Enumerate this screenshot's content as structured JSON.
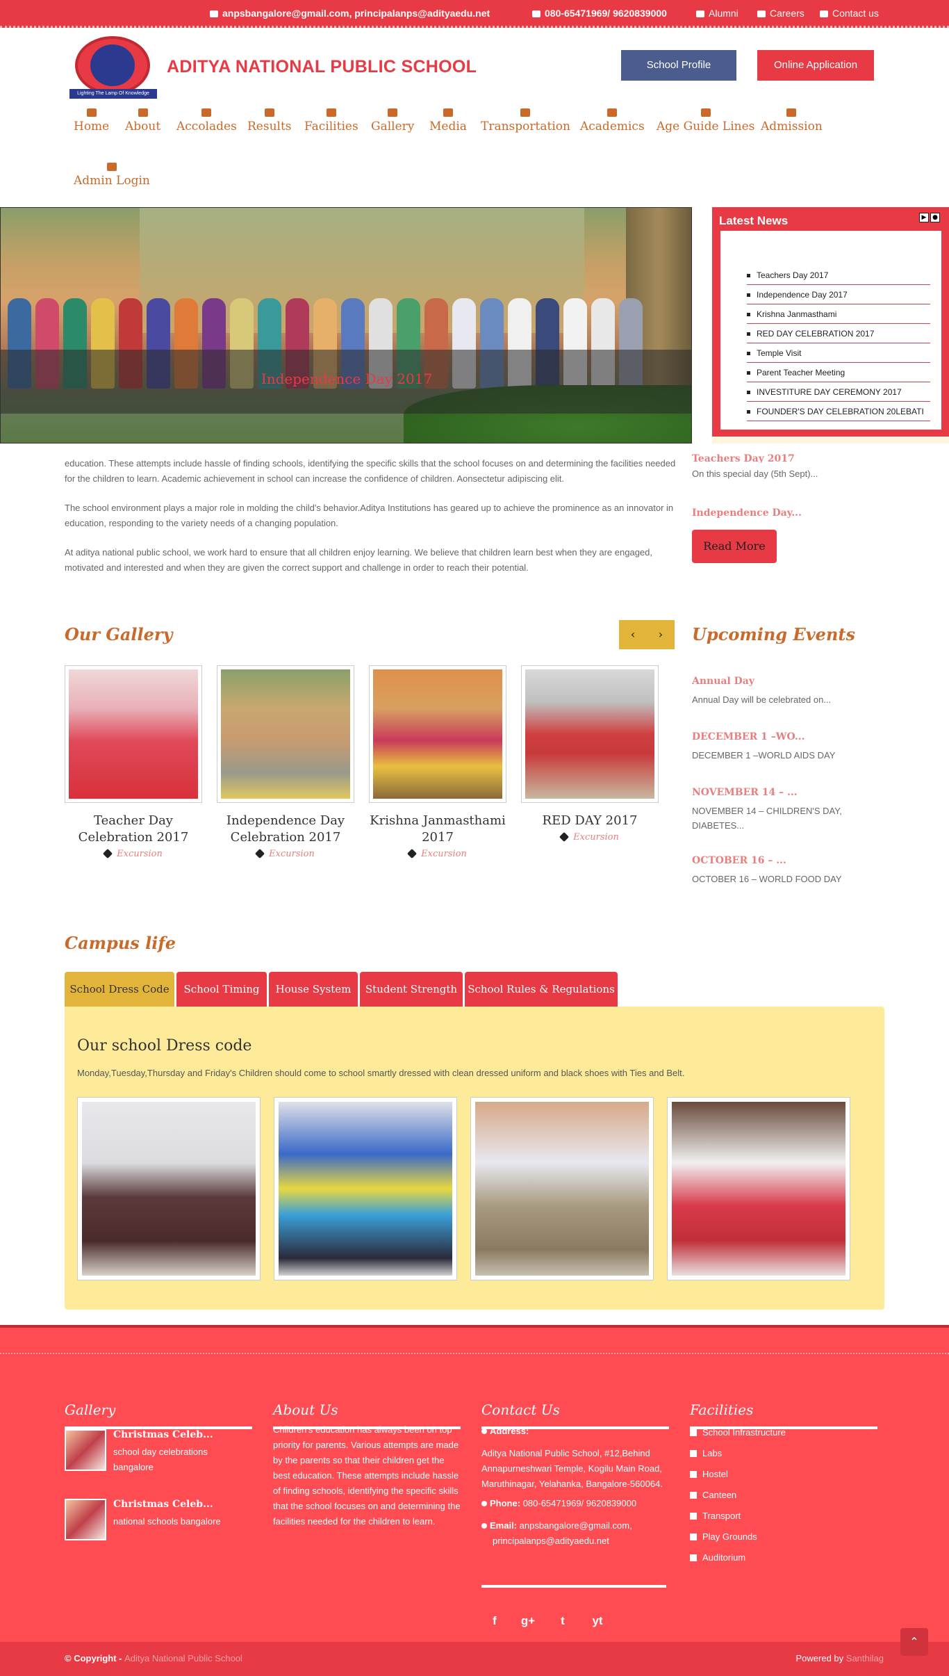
{
  "topbar": {
    "email": "anpsbangalore@gmail.com, principalanps@adityaedu.net",
    "phone": "080-65471969/ 9620839000",
    "links": [
      "Alumni",
      "Careers",
      "Contact us"
    ]
  },
  "header": {
    "logo_text": "Lighting The Lamp Of Knowledge",
    "title": "ADITYA NATIONAL PUBLIC SCHOOL",
    "profile_button": "School Profile",
    "apply_button": "Online Application"
  },
  "nav": {
    "items": [
      "Home",
      "About",
      "Accolades",
      "Results",
      "Facilities",
      "Gallery",
      "Media",
      "Transportation",
      "Academics",
      "Age Guide Lines",
      "Admission",
      "Admin Login"
    ]
  },
  "slider": {
    "caption": "Independence Day 2017"
  },
  "latest_news": {
    "title": "Latest News",
    "items": [
      "Teachers Day 2017",
      "Independence Day 2017",
      "Krishna Janmasthami",
      "RED DAY CELEBRATION 2017",
      "Temple Visit",
      "Parent Teacher Meeting",
      "INVESTITURE DAY CEREMONY 2017",
      "FOUNDER'S DAY CELEBRATION 20LEBATI"
    ]
  },
  "intro": {
    "p1": "education. These attempts include hassle of finding schools, identifying the specific skills that the school focuses on and determining the facilities needed for the children to learn. Academic achievement in school can increase the confidence of children. Aonsectetur adipiscing elit.",
    "p2": "The school environment plays a major role in molding the child's behavior.Aditya Institutions has geared up to achieve the prominence as an innovator in education, responding to the variety needs of a changing population.",
    "p3": "At aditya national public school, we work hard to ensure that all children enjoy learning. We believe that children learn best when they are engaged, motivated and interested and when they are given the correct support and challenge in order to reach their potential."
  },
  "side_news": {
    "item1_title": "Teachers Day 2017",
    "item1_desc": "On this special day (5th Sept)...",
    "item2_title": "Independence Day...",
    "read_more": "Read More"
  },
  "gallery": {
    "title": "Our Gallery",
    "items": [
      {
        "caption": "Teacher Day Celebration 2017",
        "tag": "Excursion"
      },
      {
        "caption": "Independence Day Celebration 2017",
        "tag": "Excursion"
      },
      {
        "caption": "Krishna Janmasthami 2017",
        "tag": "Excursion"
      },
      {
        "caption": "RED DAY 2017",
        "tag": "Excursion"
      }
    ]
  },
  "events": {
    "title": "Upcoming Events",
    "items": [
      {
        "title": "Annual Day",
        "desc": "Annual Day will be celebrated on..."
      },
      {
        "title": "DECEMBER 1 –WO...",
        "desc": "DECEMBER 1 –WORLD AIDS DAY"
      },
      {
        "title": "NOVEMBER 14 – ...",
        "desc": "NOVEMBER 14 – CHILDREN'S DAY, DIABETES..."
      },
      {
        "title": "OCTOBER 16 – ...",
        "desc": "OCTOBER  16 – WORLD FOOD DAY"
      }
    ]
  },
  "campus": {
    "title": "Campus life",
    "tabs": [
      "School Dress Code",
      "School Timing",
      "House System",
      "Student Strength",
      "School Rules & Regulations"
    ],
    "panel_title": "Our school Dress code",
    "panel_desc": "Monday,Tuesday,Thursday and Friday's Children should come to school smartly dressed with clean dressed uniform and black shoes with Ties and Belt."
  },
  "footer": {
    "gallery_title": "Gallery",
    "gallery_items": [
      {
        "title": "Christmas Celeb...",
        "desc": "school day celebrations bangalore"
      },
      {
        "title": "Christmas Celeb...",
        "desc": "national schools bangalore"
      }
    ],
    "about_title": "About Us",
    "about_text": "Children's education has always been on top priority for parents. Various attempts are made by the parents so that their children get the best education. These attempts include hassle of finding schools, identifying the specific skills that the school focuses on and determining the facilities needed for the children to learn.",
    "contact_title": "Contact Us",
    "address_label": "Address:",
    "address": "Aditya National Public School, #12,Behind Annapurneshwari Temple, Kogilu Main Road, Maruthinagar, Yelahanka, Bangalore-560064.",
    "phone_label": "Phone:",
    "phone": "080-65471969/ 9620839000",
    "email_label": "Email:",
    "email": "anpsbangalore@gmail.com, principalanps@adityaedu.net",
    "social": [
      "f",
      "g+",
      "t",
      "yt"
    ],
    "facilities_title": "Facilities",
    "facilities": [
      "School Infrastructure",
      "Labs",
      "Hostel",
      "Canteen",
      "Transport",
      "Play Grounds",
      "Auditorium"
    ],
    "copyright_prefix": "© Copyright - ",
    "copyright_name": "Aditya National Public School",
    "powered_prefix": "Powered by ",
    "powered_name": "Santhilag"
  },
  "colors": {
    "primary": "#e73a44",
    "accent": "#e3b43a",
    "heading": "#c96a2a",
    "panel": "#fdeb99"
  }
}
